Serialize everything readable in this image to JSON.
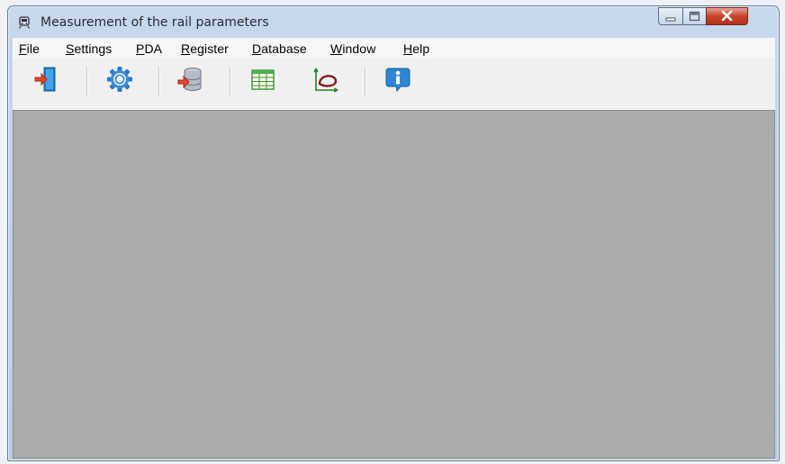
{
  "window": {
    "title": "Measurement of the rail parameters",
    "controls": {
      "minimize": "minimize",
      "maximize": "maximize",
      "close": "close"
    }
  },
  "menu": {
    "items": [
      {
        "label": "File",
        "accel": "F"
      },
      {
        "label": "Settings",
        "accel": "S"
      },
      {
        "label": "PDA",
        "accel": "P"
      },
      {
        "label": "Register",
        "accel": "R"
      },
      {
        "label": "Database",
        "accel": "D"
      },
      {
        "label": "Window",
        "accel": "W"
      },
      {
        "label": "Help",
        "accel": "H"
      }
    ]
  },
  "toolbar": {
    "buttons": [
      {
        "icon": "exit-door-icon"
      },
      {
        "icon": "settings-gear-icon"
      },
      {
        "icon": "database-import-icon"
      },
      {
        "icon": "table-grid-icon"
      },
      {
        "icon": "rail-profile-chart-icon"
      },
      {
        "icon": "info-icon"
      }
    ]
  },
  "colors": {
    "client_area": "#ababab",
    "title_gradient": "#c9d9ec",
    "close_button": "#c7432b"
  }
}
